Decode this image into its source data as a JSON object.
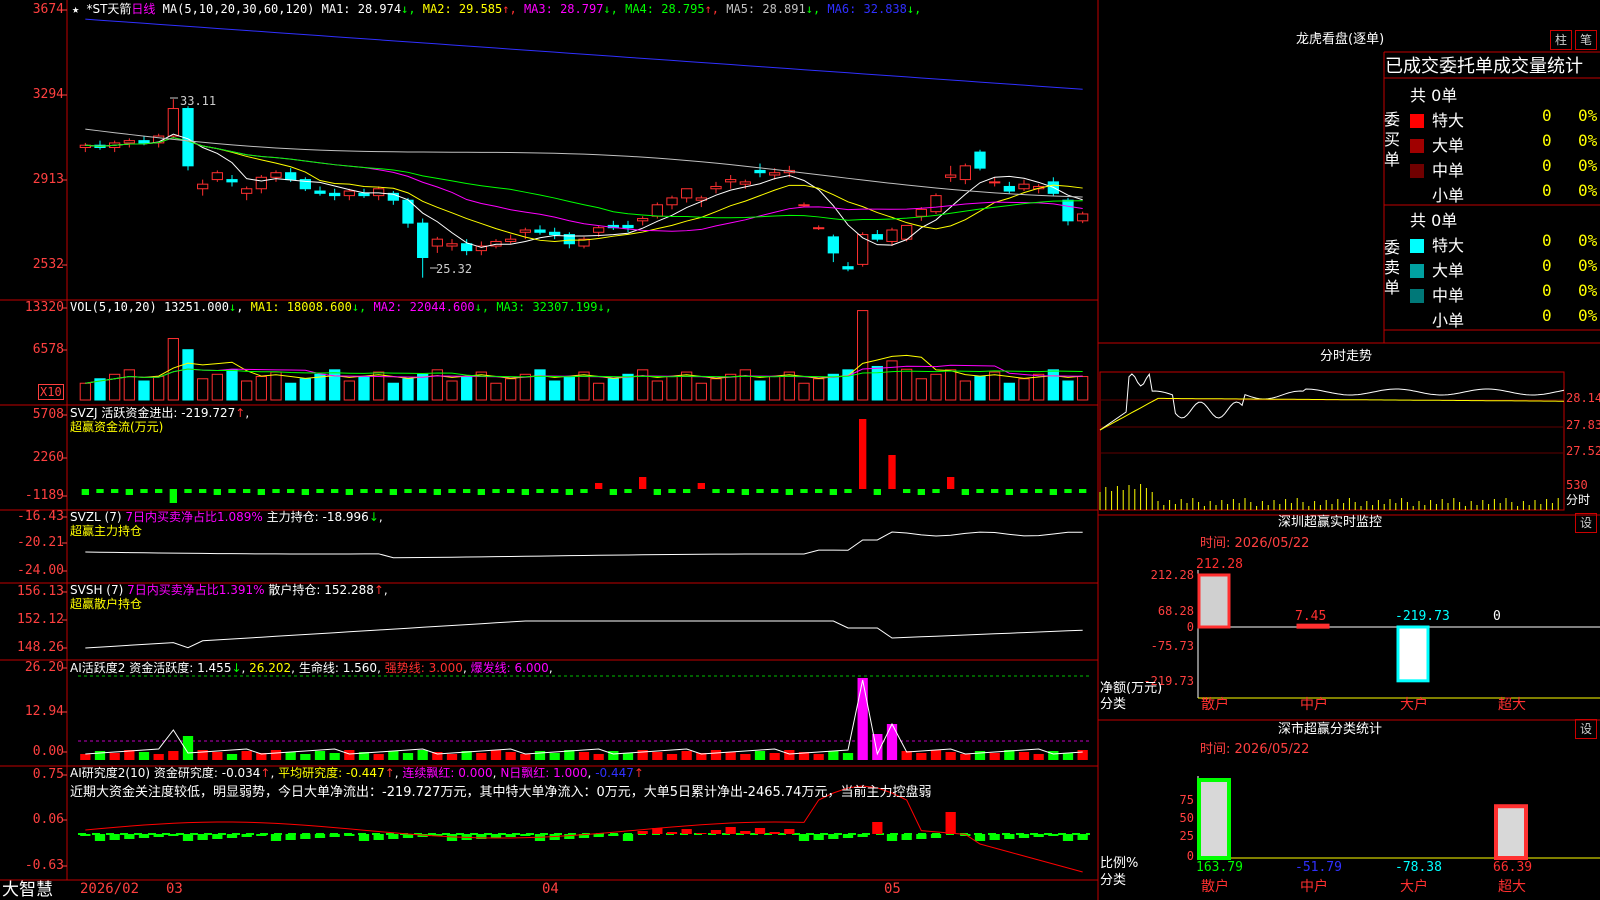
{
  "header": {
    "star": "★",
    "stock_name": "*ST天箭",
    "period": "日线",
    "ma_label": "MA(5,10,20,30,60,120)",
    "ma": [
      {
        "name": "MA1",
        "value": "28.974",
        "arrow": "↓",
        "color": "#ffffff"
      },
      {
        "name": "MA2",
        "value": "29.585",
        "arrow": "↑",
        "color": "#ffff00"
      },
      {
        "name": "MA3",
        "value": "28.797",
        "arrow": "↓",
        "color": "#ff00ff"
      },
      {
        "name": "MA4",
        "value": "28.795",
        "arrow": "↑",
        "color": "#00ff00"
      },
      {
        "name": "MA5",
        "value": "28.891",
        "arrow": "↓",
        "color": "#c0c0c0"
      },
      {
        "name": "MA6",
        "value": "32.838",
        "arrow": "↓",
        "color": "#3030ff"
      }
    ]
  },
  "axes": {
    "price": [
      "3674",
      "3294",
      "2913",
      "2532"
    ],
    "vol": [
      "13320",
      "6578"
    ],
    "vol_unit": "X10",
    "svzj": [
      "5708",
      "2260",
      "-1189"
    ],
    "svzl": [
      "-16.43",
      "-20.21",
      "-24.00"
    ],
    "svsh": [
      "156.13",
      "152.12",
      "148.26"
    ],
    "ai1": [
      "26.20",
      "12.94",
      "0.00"
    ],
    "ai2": [
      "0.75",
      "0.06",
      "-0.63"
    ]
  },
  "annotations": {
    "high": "33.11",
    "low": "25.32"
  },
  "vol_header": {
    "label": "VOL(5,10,20)",
    "value": "13251.000",
    "arrow": "↓",
    "ma": [
      {
        "name": "MA1",
        "value": "18008.600",
        "arrow": "↓",
        "color": "#ffff00"
      },
      {
        "name": "MA2",
        "value": "22044.600",
        "arrow": "↓",
        "color": "#ff00ff"
      },
      {
        "name": "MA3",
        "value": "32307.199",
        "arrow": "↓",
        "color": "#00ff00"
      }
    ]
  },
  "svzj_header": {
    "name": "SVZJ",
    "label": "活跃资金进出:",
    "value": "-219.727",
    "arrow": "↑",
    "tail": ",",
    "sub": "超赢资金流(万元)"
  },
  "svzl_header": {
    "name": "SVZL (7)",
    "label1": "7日内买卖净占比1.089%",
    "label2": "主力持仓:",
    "value": "-18.996",
    "arrow": "↓",
    "tail": ",",
    "sub": "超赢主力持仓"
  },
  "svsh_header": {
    "name": "SVSH (7)",
    "label1": "7日内买卖净占比1.391%",
    "label2": "散户持仓:",
    "value": "152.288",
    "arrow": "↑",
    "tail": ",",
    "sub": "超赢散户持仓"
  },
  "ai1_header": {
    "name": "AI活跃度2",
    "label": "资金活跃度:",
    "value": "1.455",
    "arrow": "↓",
    "v2": "26.202",
    "life_label": "生命线:",
    "life": "1.560",
    "strong": "强势线: 3.000",
    "burst": "爆发线: 6.000"
  },
  "ai2_header": {
    "name": "AI研究度2(10)",
    "label": "资金研究度:",
    "value": "-0.034",
    "arrow1": "↑",
    "avg_label": "平均研究度:",
    "avg": "-0.447",
    "arrow2": "↑",
    "red_label": "连续飘红:",
    "red": "0.000",
    "nred_label": "N日飘红:",
    "nred": "1.000",
    "last": "-0.447",
    "arrow3": "↑"
  },
  "comment": "近期大资金关注度较低，明显弱势，今日大单净流出：-219.727万元，其中特大单净流入：0万元，大单5日累计净出-2465.74万元，当前主力控盘弱",
  "bottom_axis": {
    "brand": "大智慧",
    "dates": [
      "2026/02",
      "03",
      "04",
      "05"
    ]
  },
  "right_panel": {
    "title": "龙虎看盘(逐单)",
    "btn_zhu": "柱",
    "btn_bi": "笔",
    "stats_title": "已成交委托单成交量统计",
    "buy_label": "委买单",
    "sell_label": "委卖单",
    "buy_total": "共 0单",
    "sell_total": "共 0单",
    "buy_rows": [
      {
        "label": "特大",
        "count": "0",
        "pct": "0%",
        "color": "#ff0000"
      },
      {
        "label": "大单",
        "count": "0",
        "pct": "0%",
        "color": "#a00000"
      },
      {
        "label": "中单",
        "count": "0",
        "pct": "0%",
        "color": "#700000"
      },
      {
        "label": "小单",
        "count": "0",
        "pct": "0%",
        "color": "#000000"
      }
    ],
    "sell_rows": [
      {
        "label": "特大",
        "count": "0",
        "pct": "0%",
        "color": "#00ffff"
      },
      {
        "label": "大单",
        "count": "0",
        "pct": "0%",
        "color": "#00a0a0"
      },
      {
        "label": "中单",
        "count": "0",
        "pct": "0%",
        "color": "#007878"
      },
      {
        "label": "小单",
        "count": "0",
        "pct": "0%",
        "color": "#000000"
      }
    ],
    "intraday_title": "分时走势",
    "intraday_axis": [
      "28.14",
      "27.83",
      "27.52"
    ],
    "intraday_vol": "530",
    "intraday_unit": "分时",
    "monitor_title": "深圳超赢实时监控",
    "monitor_btn": "设",
    "monitor_time": "时间: 2026/05/22",
    "monitor_axis": [
      "212.28",
      "68.28",
      "0",
      "-75.73",
      "-219.73"
    ],
    "monitor_label": "净额(万元)",
    "monitor_cat_label": "分类",
    "monitor_values": [
      "212.28",
      "7.45",
      "-219.73",
      "0"
    ],
    "monitor_cats": [
      "散户",
      "中户",
      "大户",
      "超大"
    ],
    "dist_title": "深市超赢分类统计",
    "dist_btn": "设",
    "dist_time": "时间: 2026/05/22",
    "dist_axis": [
      "75",
      "50",
      "25",
      "0"
    ],
    "dist_label": "比例%",
    "dist_cat_label": "分类",
    "dist_values": [
      "163.79",
      "-51.79",
      "-78.38",
      "66.39"
    ],
    "dist_cats": [
      "散户",
      "中户",
      "大户",
      "超大"
    ]
  },
  "chart_data": {
    "type": "candlestick",
    "note_series": "daily K-line with moving averages",
    "candles": [
      [
        31.0,
        31.2,
        30.8,
        31.1
      ],
      [
        31.1,
        31.3,
        30.9,
        31.0
      ],
      [
        31.0,
        31.3,
        30.8,
        31.2
      ],
      [
        31.2,
        31.4,
        31.0,
        31.3
      ],
      [
        31.3,
        31.5,
        31.1,
        31.2
      ],
      [
        31.2,
        31.6,
        31.0,
        31.5
      ],
      [
        31.5,
        33.11,
        31.4,
        32.7
      ],
      [
        32.7,
        32.8,
        30.0,
        30.2
      ],
      [
        29.2,
        29.6,
        28.9,
        29.4
      ],
      [
        29.6,
        30.0,
        29.5,
        29.9
      ],
      [
        29.6,
        29.8,
        29.3,
        29.5
      ],
      [
        29.0,
        29.3,
        28.7,
        29.2
      ],
      [
        29.2,
        29.8,
        29.0,
        29.7
      ],
      [
        29.7,
        30.0,
        29.5,
        29.9
      ],
      [
        29.9,
        30.1,
        29.5,
        29.6
      ],
      [
        29.6,
        29.7,
        29.1,
        29.2
      ],
      [
        29.1,
        29.3,
        28.9,
        29.0
      ],
      [
        29.0,
        29.2,
        28.7,
        28.9
      ],
      [
        28.9,
        29.2,
        28.7,
        29.1
      ],
      [
        29.0,
        29.2,
        28.8,
        28.9
      ],
      [
        28.9,
        29.3,
        28.7,
        29.2
      ],
      [
        29.0,
        29.1,
        28.5,
        28.7
      ],
      [
        28.7,
        28.8,
        27.5,
        27.7
      ],
      [
        27.7,
        27.9,
        25.32,
        26.2
      ],
      [
        26.7,
        27.1,
        26.4,
        27.0
      ],
      [
        26.7,
        27.0,
        26.5,
        26.8
      ],
      [
        26.8,
        27.0,
        26.3,
        26.5
      ],
      [
        26.5,
        26.9,
        26.3,
        26.7
      ],
      [
        26.7,
        27.0,
        26.6,
        26.9
      ],
      [
        26.9,
        27.2,
        26.8,
        27.0
      ],
      [
        27.3,
        27.5,
        27.0,
        27.4
      ],
      [
        27.4,
        27.6,
        27.2,
        27.3
      ],
      [
        27.3,
        27.5,
        27.0,
        27.2
      ],
      [
        27.2,
        27.3,
        26.6,
        26.8
      ],
      [
        26.7,
        27.1,
        26.6,
        27.0
      ],
      [
        27.3,
        27.6,
        27.1,
        27.5
      ],
      [
        27.6,
        27.8,
        27.4,
        27.5
      ],
      [
        27.6,
        27.8,
        27.3,
        27.5
      ],
      [
        27.8,
        28.0,
        27.6,
        27.9
      ],
      [
        28.0,
        28.6,
        27.9,
        28.5
      ],
      [
        28.5,
        28.9,
        28.3,
        28.8
      ],
      [
        28.8,
        29.2,
        28.6,
        29.2
      ],
      [
        28.7,
        28.9,
        28.4,
        28.8
      ],
      [
        29.2,
        29.5,
        29.0,
        29.3
      ],
      [
        29.5,
        29.8,
        29.2,
        29.6
      ],
      [
        29.4,
        29.6,
        29.2,
        29.5
      ],
      [
        30.0,
        30.3,
        29.7,
        29.9
      ],
      [
        29.8,
        30.1,
        29.6,
        29.9
      ],
      [
        29.9,
        30.2,
        29.7,
        30.0
      ],
      [
        28.5,
        28.6,
        28.4,
        28.5
      ],
      [
        27.5,
        27.6,
        27.4,
        27.5
      ],
      [
        27.1,
        27.2,
        26.0,
        26.4
      ],
      [
        25.8,
        26.0,
        25.6,
        25.7
      ],
      [
        25.9,
        27.3,
        25.8,
        27.2
      ],
      [
        27.2,
        27.4,
        26.9,
        27.0
      ],
      [
        26.9,
        27.5,
        26.7,
        27.4
      ],
      [
        27.0,
        27.6,
        26.9,
        27.6
      ],
      [
        28.0,
        28.4,
        27.8,
        28.3
      ],
      [
        28.2,
        29.0,
        28.1,
        28.9
      ],
      [
        29.7,
        30.2,
        29.5,
        29.8
      ],
      [
        29.6,
        30.3,
        29.4,
        30.2
      ],
      [
        30.8,
        30.9,
        30.0,
        30.1
      ],
      [
        29.5,
        29.7,
        29.3,
        29.5
      ],
      [
        29.3,
        29.5,
        29.0,
        29.1
      ],
      [
        29.2,
        29.6,
        29.1,
        29.4
      ],
      [
        29.2,
        29.4,
        29.0,
        29.3
      ],
      [
        29.5,
        29.7,
        28.9,
        29.0
      ],
      [
        28.7,
        28.8,
        27.6,
        27.8
      ],
      [
        27.8,
        28.2,
        27.7,
        28.1
      ]
    ]
  }
}
